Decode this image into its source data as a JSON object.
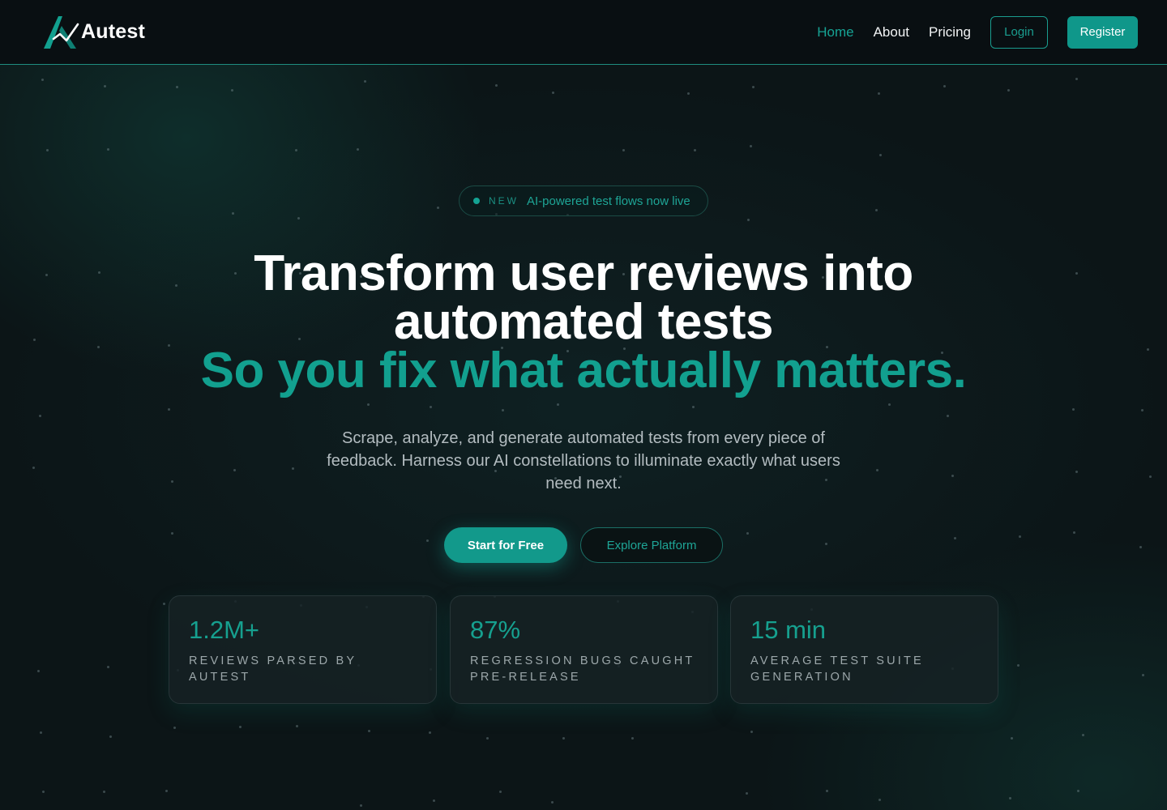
{
  "nav": {
    "brand": "Autest",
    "links": [
      {
        "label": "Home",
        "active": true
      },
      {
        "label": "About",
        "active": false
      },
      {
        "label": "Pricing",
        "active": false
      }
    ],
    "login_label": "Login",
    "register_label": "Register"
  },
  "hero": {
    "badge_tag": "NEW",
    "badge_text": "AI-powered test flows now live",
    "headline_line1": "Transform user reviews into",
    "headline_line2": "automated tests",
    "headline_accent": "So you fix what actually matters.",
    "subtitle": "Scrape, analyze, and generate automated tests from every piece of feedback. Harness our AI constellations to illuminate exactly what users need next.",
    "cta_primary": "Start for Free",
    "cta_secondary": "Explore Platform"
  },
  "stats": [
    {
      "value": "1.2M+",
      "label": "Reviews parsed by Autest"
    },
    {
      "value": "87%",
      "label": "Regression bugs caught pre-release"
    },
    {
      "value": "15 min",
      "label": "Average test suite generation"
    }
  ],
  "colors": {
    "accent": "#12a08f",
    "background": "#0c1517",
    "nav_background": "#090f12"
  }
}
